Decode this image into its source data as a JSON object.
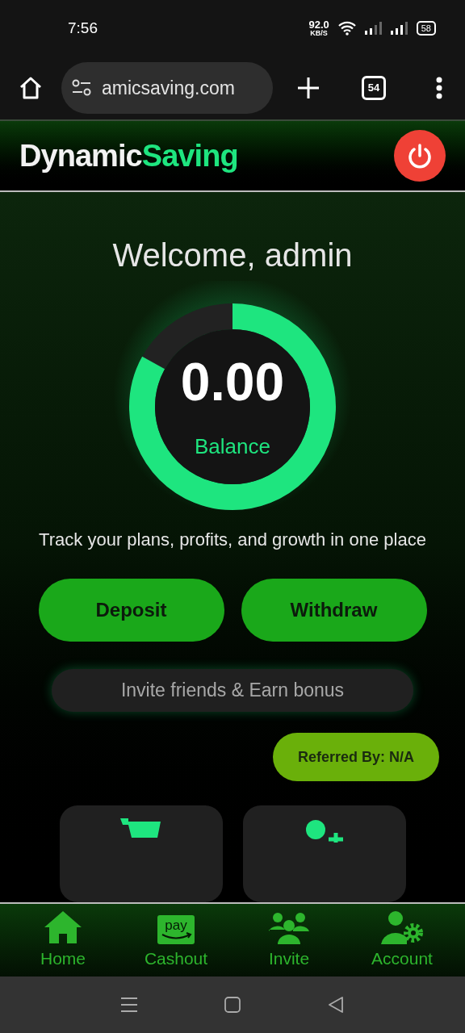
{
  "status_bar": {
    "time": "7:56",
    "net_speed": "92.0",
    "net_unit": "KB/S",
    "battery": "58"
  },
  "browser": {
    "url": "amicsaving.com",
    "tab_count": "54"
  },
  "header": {
    "logo": [
      {
        "text": "Dynamic",
        "color": "#f2f2f2"
      },
      {
        "text": "Saving",
        "color": "#1ee57f"
      }
    ]
  },
  "welcome": "Welcome, admin",
  "balance": {
    "amount": "0.00",
    "label": "Balance",
    "level": 0.83
  },
  "tagline": "Track your plans, profits, and growth in one place",
  "actions": [
    "Deposit",
    "Withdraw"
  ],
  "invite": "Invite friends & Earn bonus",
  "referred": "Referred By: N/A",
  "cards": [
    {
      "kind": "cart"
    },
    {
      "kind": "user"
    }
  ],
  "bottom_nav": [
    {
      "label": "Home",
      "kind": "home"
    },
    {
      "label": "Cashout",
      "kind": "pay",
      "icon_text": "pay"
    },
    {
      "label": "Invite",
      "kind": "group"
    },
    {
      "label": "Account",
      "kind": "account"
    }
  ]
}
